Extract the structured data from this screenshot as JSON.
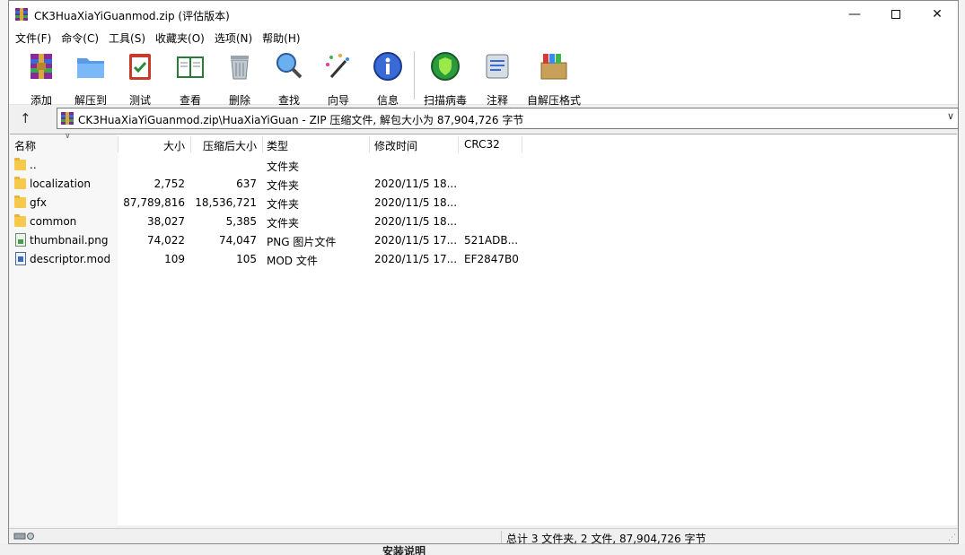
{
  "window": {
    "title": "CK3HuaXiaYiGuanmod.zip (评估版本)",
    "minimize": "—",
    "close": "✕"
  },
  "menu": [
    "文件(F)",
    "命令(C)",
    "工具(S)",
    "收藏夹(O)",
    "选项(N)",
    "帮助(H)"
  ],
  "toolbar": [
    {
      "label": "添加",
      "icon": "add-archive-icon"
    },
    {
      "label": "解压到",
      "icon": "extract-folder-icon"
    },
    {
      "label": "测试",
      "icon": "test-clipboard-icon"
    },
    {
      "label": "查看",
      "icon": "view-book-icon"
    },
    {
      "label": "删除",
      "icon": "trash-bin-icon"
    },
    {
      "label": "查找",
      "icon": "magnifier-icon"
    },
    {
      "label": "向导",
      "icon": "wizard-wand-icon"
    },
    {
      "label": "信息",
      "icon": "info-icon"
    },
    {
      "label": "扫描病毒",
      "icon": "virus-scan-icon"
    },
    {
      "label": "注释",
      "icon": "comment-icon"
    },
    {
      "label": "自解压格式",
      "icon": "sfx-box-icon"
    }
  ],
  "address": {
    "up": "↑",
    "path": "CK3HuaXiaYiGuanmod.zip\\HuaXiaYiGuan - ZIP 压缩文件, 解包大小为 87,904,726 字节",
    "dropdown": "∨"
  },
  "columns": {
    "name": "名称",
    "size": "大小",
    "packed": "压缩后大小",
    "type": "类型",
    "modified": "修改时间",
    "crc": "CRC32",
    "sort_indicator": "∨"
  },
  "files": [
    {
      "name": "..",
      "size": "",
      "packed": "",
      "type": "文件夹",
      "modified": "",
      "crc": "",
      "kind": "folder"
    },
    {
      "name": "localization",
      "size": "2,752",
      "packed": "637",
      "type": "文件夹",
      "modified": "2020/11/5 18...",
      "crc": "",
      "kind": "folder"
    },
    {
      "name": "gfx",
      "size": "87,789,816",
      "packed": "18,536,721",
      "type": "文件夹",
      "modified": "2020/11/5 18...",
      "crc": "",
      "kind": "folder"
    },
    {
      "name": "common",
      "size": "38,027",
      "packed": "5,385",
      "type": "文件夹",
      "modified": "2020/11/5 18...",
      "crc": "",
      "kind": "folder"
    },
    {
      "name": "thumbnail.png",
      "size": "74,022",
      "packed": "74,047",
      "type": "PNG 图片文件",
      "modified": "2020/11/5 17...",
      "crc": "521ADB...",
      "kind": "png"
    },
    {
      "name": "descriptor.mod",
      "size": "109",
      "packed": "105",
      "type": "MOD 文件",
      "modified": "2020/11/5 17...",
      "crc": "EF2847B0",
      "kind": "mod"
    }
  ],
  "status": {
    "summary": "总计 3 文件夹, 2 文件, 87,904,726 字节"
  },
  "background": {
    "peek_text": "安装说明"
  }
}
